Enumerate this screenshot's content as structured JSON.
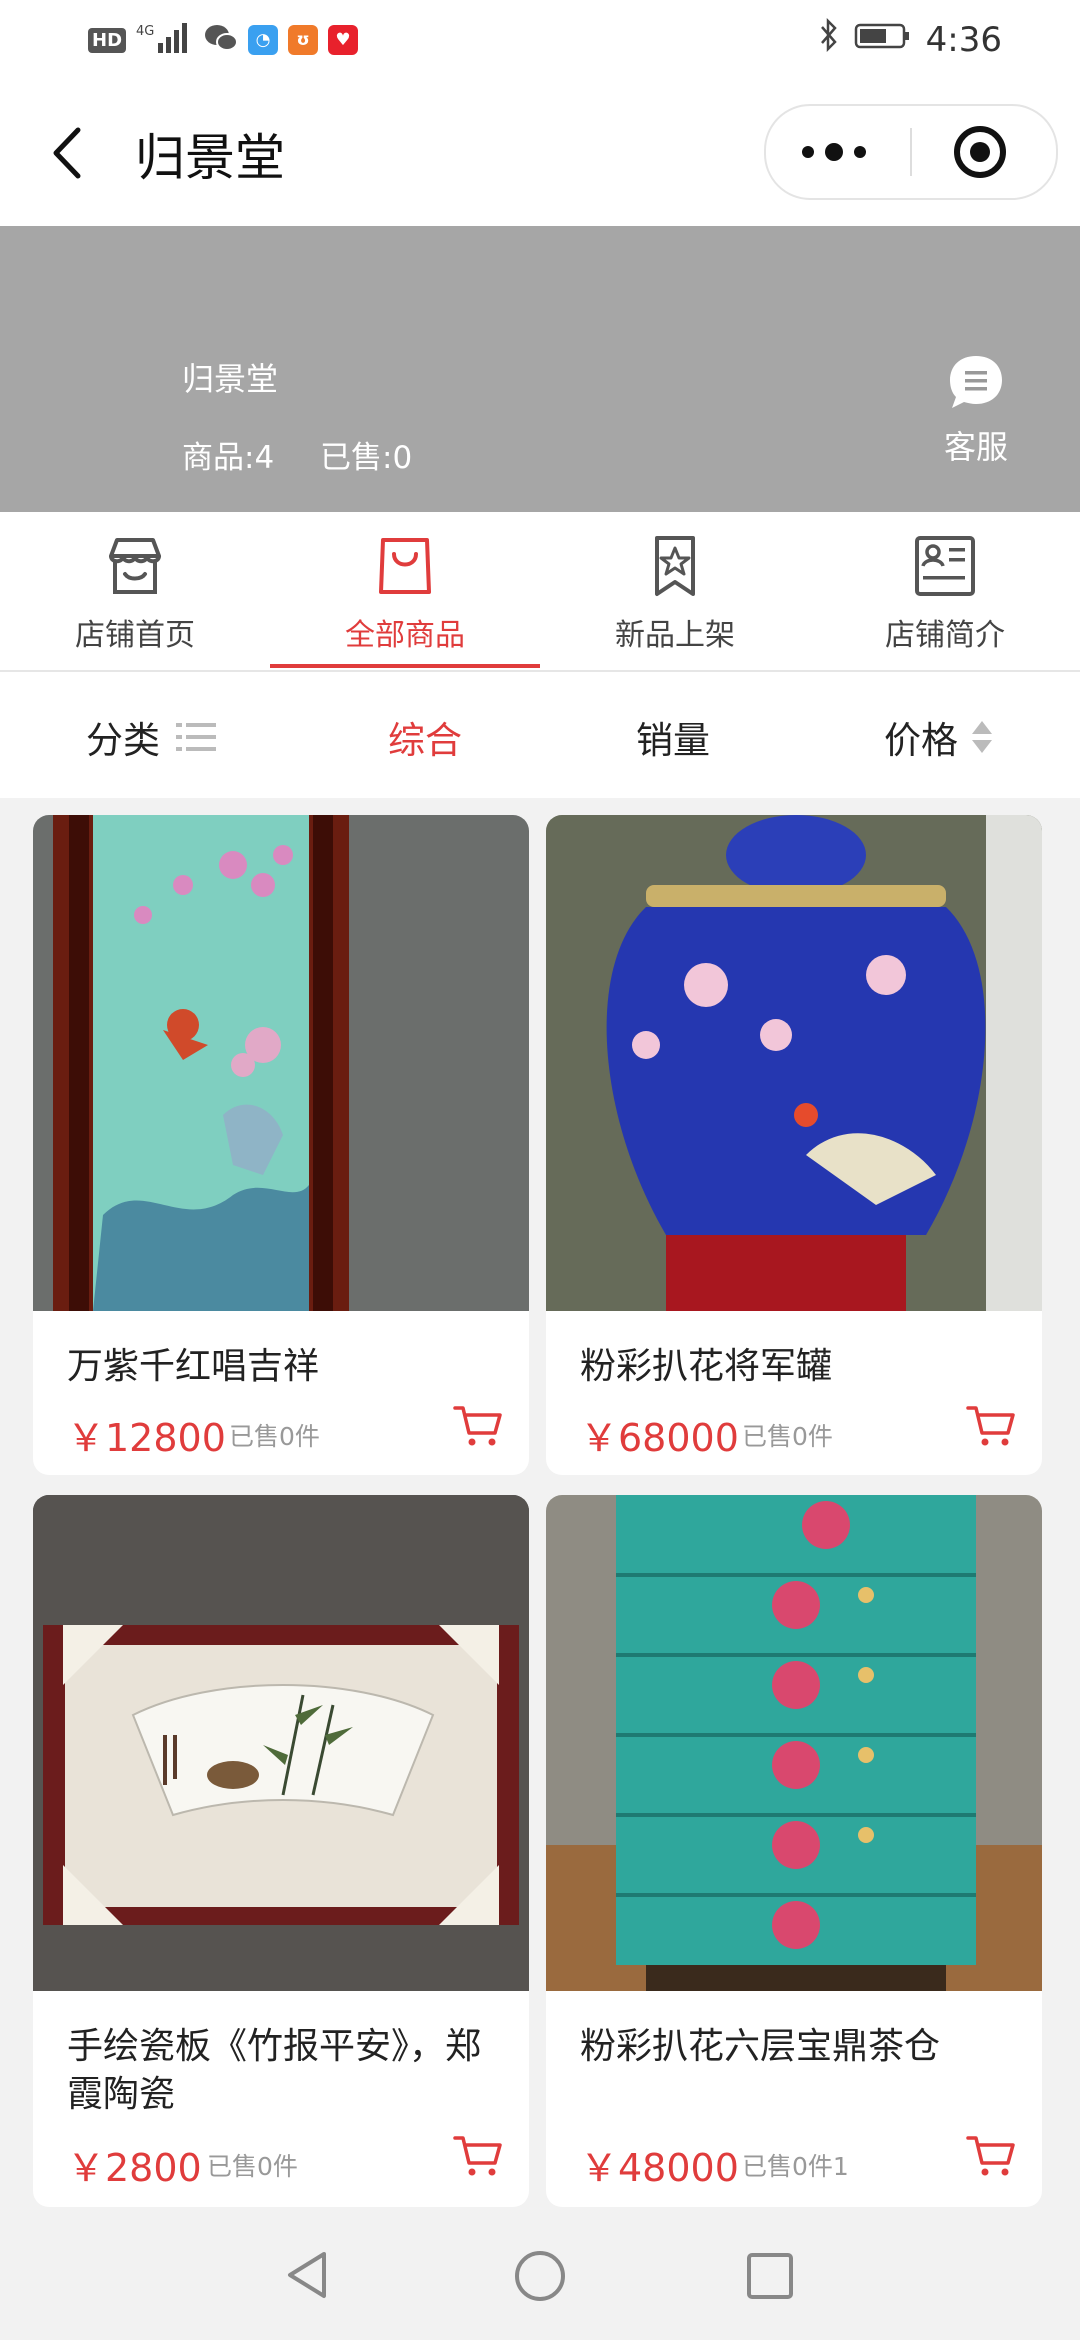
{
  "status_bar": {
    "left_icons": [
      "HD",
      "4G",
      "signal-icon",
      "wechat-icon",
      "qq-browser-icon",
      "squirrel-app-icon",
      "heart-app-icon"
    ],
    "time": "4:36"
  },
  "nav": {
    "title": "归景堂"
  },
  "banner": {
    "shop_name": "归景堂",
    "goods_count": "商品:4",
    "sold_count": "已售:0",
    "service_label": "客服"
  },
  "tabs": [
    {
      "label": "店铺首页",
      "icon": "store-icon"
    },
    {
      "label": "全部商品",
      "icon": "shopping-bag-icon"
    },
    {
      "label": "新品上架",
      "icon": "bookmark-star-icon"
    },
    {
      "label": "店铺简介",
      "icon": "profile-card-icon"
    }
  ],
  "sort": {
    "category": "分类",
    "overall": "综合",
    "sales": "销量",
    "price": "价格"
  },
  "products": [
    {
      "name": "万紫千红唱吉祥",
      "price": "￥12800",
      "sold": "已售0件"
    },
    {
      "name": "粉彩扒花将军罐",
      "price": "￥68000",
      "sold": "已售0件"
    },
    {
      "name": "手绘瓷板《竹报平安》，郑霞陶瓷",
      "price": "￥2800",
      "sold": "已售0件"
    },
    {
      "name": "粉彩扒花六层宝鼎茶仓",
      "price": "￥48000",
      "sold": "已售0件1"
    }
  ],
  "colors": {
    "accent": "#e03c3c",
    "banner": "#a6a6a6"
  }
}
